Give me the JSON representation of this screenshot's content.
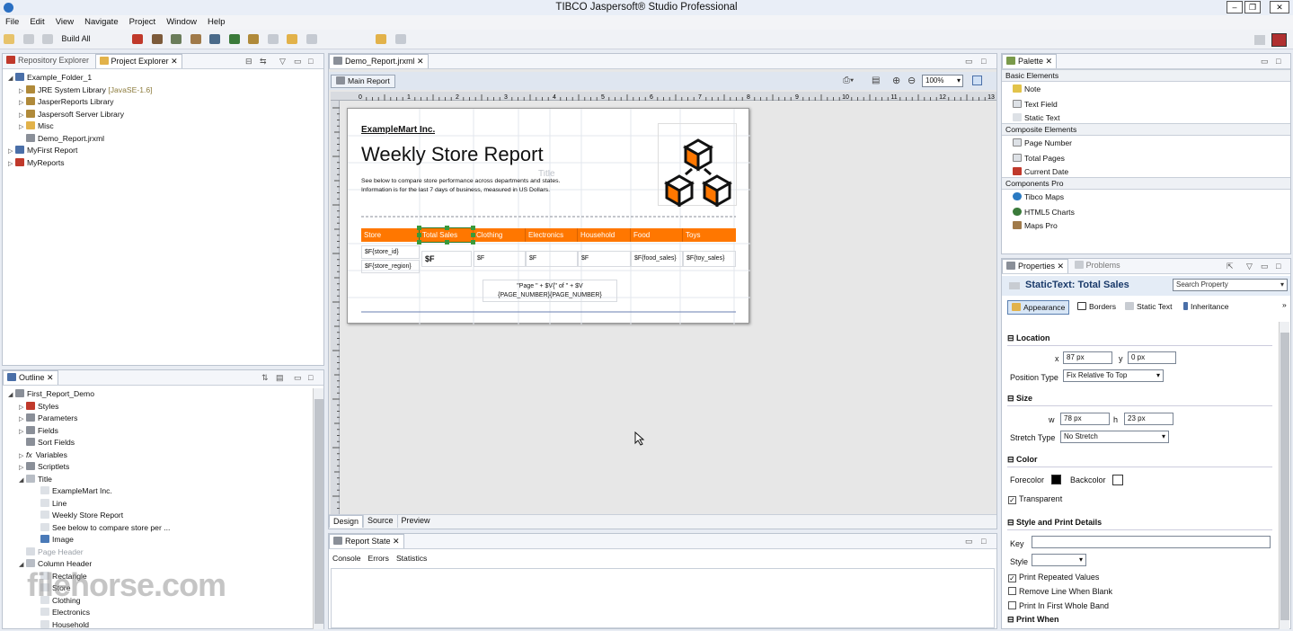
{
  "window": {
    "title": "TIBCO Jaspersoft® Studio Professional"
  },
  "menu": [
    "File",
    "Edit",
    "View",
    "Navigate",
    "Project",
    "Window",
    "Help"
  ],
  "toolbar": {
    "build_all": "Build All"
  },
  "project_explorer": {
    "tabs": [
      "Repository Explorer",
      "Project Explorer"
    ],
    "tree": {
      "root": "Example_Folder_1",
      "children": [
        "JRE System Library",
        "JasperReports Library",
        "Jaspersoft Server Library",
        "Misc",
        "Demo_Report.jrxml"
      ],
      "jre_tag": "[JavaSE-1.6]",
      "others": [
        "MyFirst Report",
        "MyReports"
      ]
    }
  },
  "outline": {
    "tab": "Outline",
    "root": "First_Report_Demo",
    "items": [
      "Styles",
      "Parameters",
      "Fields",
      "Sort Fields",
      "Variables",
      "Scriptlets",
      "Title"
    ],
    "title_children": [
      "ExampleMart Inc.",
      "Line",
      "Weekly Store Report",
      "See below to compare store per ...",
      "Image"
    ],
    "page_header": "Page Header",
    "column_header": "Column Header",
    "column_header_children": [
      "Rectangle",
      "Store",
      "Clothing",
      "Electronics",
      "Household"
    ]
  },
  "editor": {
    "tab": "Demo_Report.jrxml",
    "main_report": "Main Report",
    "zoom": "100%",
    "ruler_labels": [
      "0",
      "1",
      "2",
      "3",
      "4",
      "5",
      "6",
      "7",
      "8",
      "9",
      "10",
      "11",
      "12",
      "13"
    ],
    "bottom_tabs": [
      "Design",
      "Source",
      "Preview"
    ]
  },
  "report": {
    "company": "ExampleMart Inc.",
    "title": "Weekly Store Report",
    "title_hint": "Title",
    "description": "See below to compare store performance across departments and states. Information is for the last 7 days of business, measured in US Dollars.",
    "headers": [
      "Store",
      "Total Sales",
      "Clothing",
      "Electronics",
      "Household",
      "Food",
      "Toys"
    ],
    "row_fields": [
      "$F{store_id}",
      "$F{store_region}"
    ],
    "data_cells": [
      "$F",
      "$F",
      "$F",
      "$F",
      "$F{food_sales}",
      "$F{toy_sales}"
    ],
    "footer_line1": "\"Page \" + $V{\" of \" + $V",
    "footer_line2": "{PAGE_NUMBER}{PAGE_NUMBER}"
  },
  "report_state": {
    "tab": "Report State",
    "subtabs": [
      "Console",
      "Errors",
      "Statistics"
    ]
  },
  "palette": {
    "tab": "Palette",
    "groups": [
      {
        "name": "Basic Elements",
        "items": [
          "Note",
          "Text Field",
          "Static Text"
        ]
      },
      {
        "name": "Composite Elements",
        "items": [
          "Page Number",
          "Total Pages",
          "Current Date"
        ]
      },
      {
        "name": "Components Pro",
        "items": [
          "Tibco Maps",
          "HTML5 Charts",
          "Maps Pro"
        ]
      }
    ]
  },
  "properties": {
    "tabs": [
      "Properties",
      "Problems"
    ],
    "heading": "StaticText: Total Sales",
    "search_placeholder": "Search Property",
    "subtabs": [
      "Appearance",
      "Borders",
      "Static Text",
      "Inheritance"
    ],
    "location_label": "Location",
    "x_label": "x",
    "x_value": "87 px",
    "y_label": "y",
    "y_value": "0 px",
    "position_type_label": "Position Type",
    "position_type": "Fix Relative To Top",
    "size_label": "Size",
    "w_label": "w",
    "w_value": "78 px",
    "h_label": "h",
    "h_value": "23 px",
    "stretch_type_label": "Stretch Type",
    "stretch_type": "No Stretch",
    "color_label": "Color",
    "forecolor_label": "Forecolor",
    "forecolor": "#000000",
    "backcolor_label": "Backcolor",
    "backcolor": "#ffffff",
    "transparent_label": "Transparent",
    "style_print_label": "Style and Print Details",
    "key_label": "Key",
    "style_label": "Style",
    "print_repeated": "Print Repeated Values",
    "remove_line": "Remove Line When Blank",
    "print_first": "Print In First Whole Band",
    "print_when": "Print When"
  },
  "watermark": "filehorse.com",
  "colors": {
    "accent": "#ff7700",
    "selection": "#2a7a2a"
  }
}
